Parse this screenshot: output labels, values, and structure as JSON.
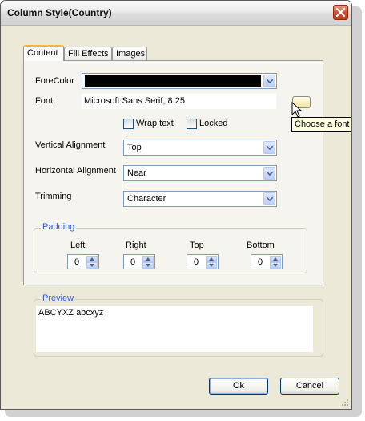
{
  "window": {
    "title": "Column Style(Country)"
  },
  "tabs": [
    "Content",
    "Fill Effects",
    "Images"
  ],
  "content": {
    "forecolor_label": "ForeColor",
    "forecolor_value": "#000000",
    "font_label": "Font",
    "font_value": "Microsoft Sans Serif, 8.25",
    "font_button_tooltip": "Choose a font",
    "wrap_text_label": "Wrap text",
    "wrap_text_checked": false,
    "locked_label": "Locked",
    "locked_checked": false,
    "vertical_alignment_label": "Vertical Alignment",
    "vertical_alignment_value": "Top",
    "horizontal_alignment_label": "Horizontal Alignment",
    "horizontal_alignment_value": "Near",
    "trimming_label": "Trimming",
    "trimming_value": "Character"
  },
  "padding": {
    "title": "Padding",
    "fields": [
      {
        "label": "Left",
        "value": "0"
      },
      {
        "label": "Right",
        "value": "0"
      },
      {
        "label": "Top",
        "value": "0"
      },
      {
        "label": "Bottom",
        "value": "0"
      }
    ]
  },
  "preview": {
    "title": "Preview",
    "text": "ABCYXZ abcxyz"
  },
  "buttons": {
    "ok": "Ok",
    "cancel": "Cancel"
  },
  "colors": {
    "title_accent": "#f4b63a",
    "group_title": "#2b5ae0",
    "tooltip_bg": "#ffffe1"
  },
  "icons": [
    "close-icon",
    "chevron-down-icon",
    "spin-up-icon",
    "spin-down-icon",
    "pointer-cursor-icon",
    "size-grip-icon"
  ]
}
